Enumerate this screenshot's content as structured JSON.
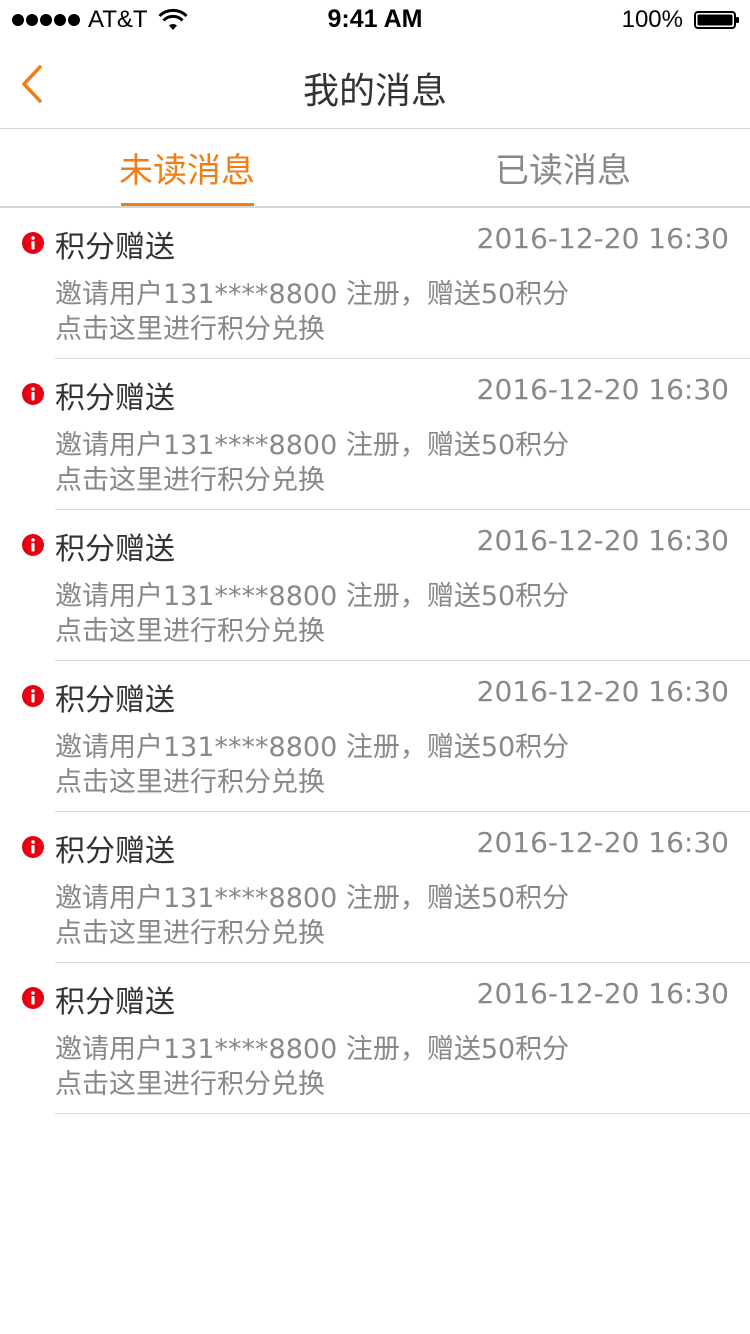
{
  "status_bar": {
    "carrier": "AT&T",
    "time": "9:41 AM",
    "battery": "100%"
  },
  "nav": {
    "title": "我的消息",
    "back_icon": "chevron-left-icon"
  },
  "tabs": [
    {
      "label": "未读消息",
      "active": true
    },
    {
      "label": "已读消息",
      "active": false
    }
  ],
  "colors": {
    "accent": "#f07e14",
    "unread_dot": "#e60012",
    "secondary_text": "#888888"
  },
  "messages": [
    {
      "title": "积分赠送",
      "time": "2016-12-20 16:30",
      "body": "邀请用户131****8800 注册，赠送50积分",
      "link": "点击这里进行积分兑换"
    },
    {
      "title": "积分赠送",
      "time": "2016-12-20 16:30",
      "body": "邀请用户131****8800 注册，赠送50积分",
      "link": "点击这里进行积分兑换"
    },
    {
      "title": "积分赠送",
      "time": "2016-12-20 16:30",
      "body": "邀请用户131****8800 注册，赠送50积分",
      "link": "点击这里进行积分兑换"
    },
    {
      "title": "积分赠送",
      "time": "2016-12-20 16:30",
      "body": "邀请用户131****8800 注册，赠送50积分",
      "link": "点击这里进行积分兑换"
    },
    {
      "title": "积分赠送",
      "time": "2016-12-20 16:30",
      "body": "邀请用户131****8800 注册，赠送50积分",
      "link": "点击这里进行积分兑换"
    },
    {
      "title": "积分赠送",
      "time": "2016-12-20 16:30",
      "body": "邀请用户131****8800 注册，赠送50积分",
      "link": "点击这里进行积分兑换"
    }
  ]
}
